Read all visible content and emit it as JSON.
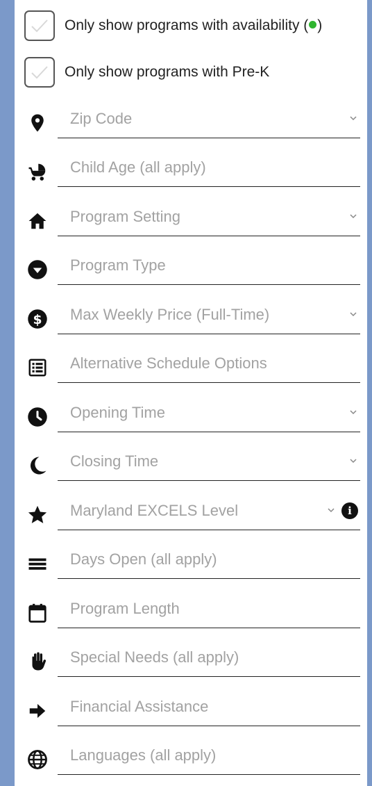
{
  "filters": {
    "availability_checkbox": {
      "label": "Only show programs with availability (",
      "suffix": ")",
      "checked": false
    },
    "prek_checkbox": {
      "label": "Only show programs with Pre-K",
      "checked": false
    },
    "fields": [
      {
        "label": "Zip Code",
        "icon": "location-pin-icon",
        "dropdown": true
      },
      {
        "label": "Child Age (all apply)",
        "icon": "stroller-icon",
        "dropdown": false
      },
      {
        "label": "Program Setting",
        "icon": "home-icon",
        "dropdown": true
      },
      {
        "label": "Program Type",
        "icon": "caret-circle-icon",
        "dropdown": false
      },
      {
        "label": "Max Weekly Price (Full-Time)",
        "icon": "dollar-icon",
        "dropdown": true
      },
      {
        "label": "Alternative Schedule Options",
        "icon": "list-icon",
        "dropdown": false
      },
      {
        "label": "Opening Time",
        "icon": "clock-icon",
        "dropdown": true
      },
      {
        "label": "Closing Time",
        "icon": "moon-icon",
        "dropdown": true
      },
      {
        "label": "Maryland EXCELS Level",
        "icon": "star-icon",
        "dropdown": true,
        "info": "i"
      },
      {
        "label": "Days Open (all apply)",
        "icon": "bars-icon",
        "dropdown": false
      },
      {
        "label": "Program Length",
        "icon": "calendar-icon",
        "dropdown": false
      },
      {
        "label": "Special Needs (all apply)",
        "icon": "hand-icon",
        "dropdown": false
      },
      {
        "label": "Financial Assistance",
        "icon": "arrow-right-icon",
        "dropdown": false
      },
      {
        "label": "Languages (all apply)",
        "icon": "globe-icon",
        "dropdown": false
      }
    ]
  },
  "colors": {
    "background": "#7b99c9",
    "panel": "#ffffff",
    "availability_dot": "#2fb52f",
    "placeholder": "#a2a2a2"
  }
}
